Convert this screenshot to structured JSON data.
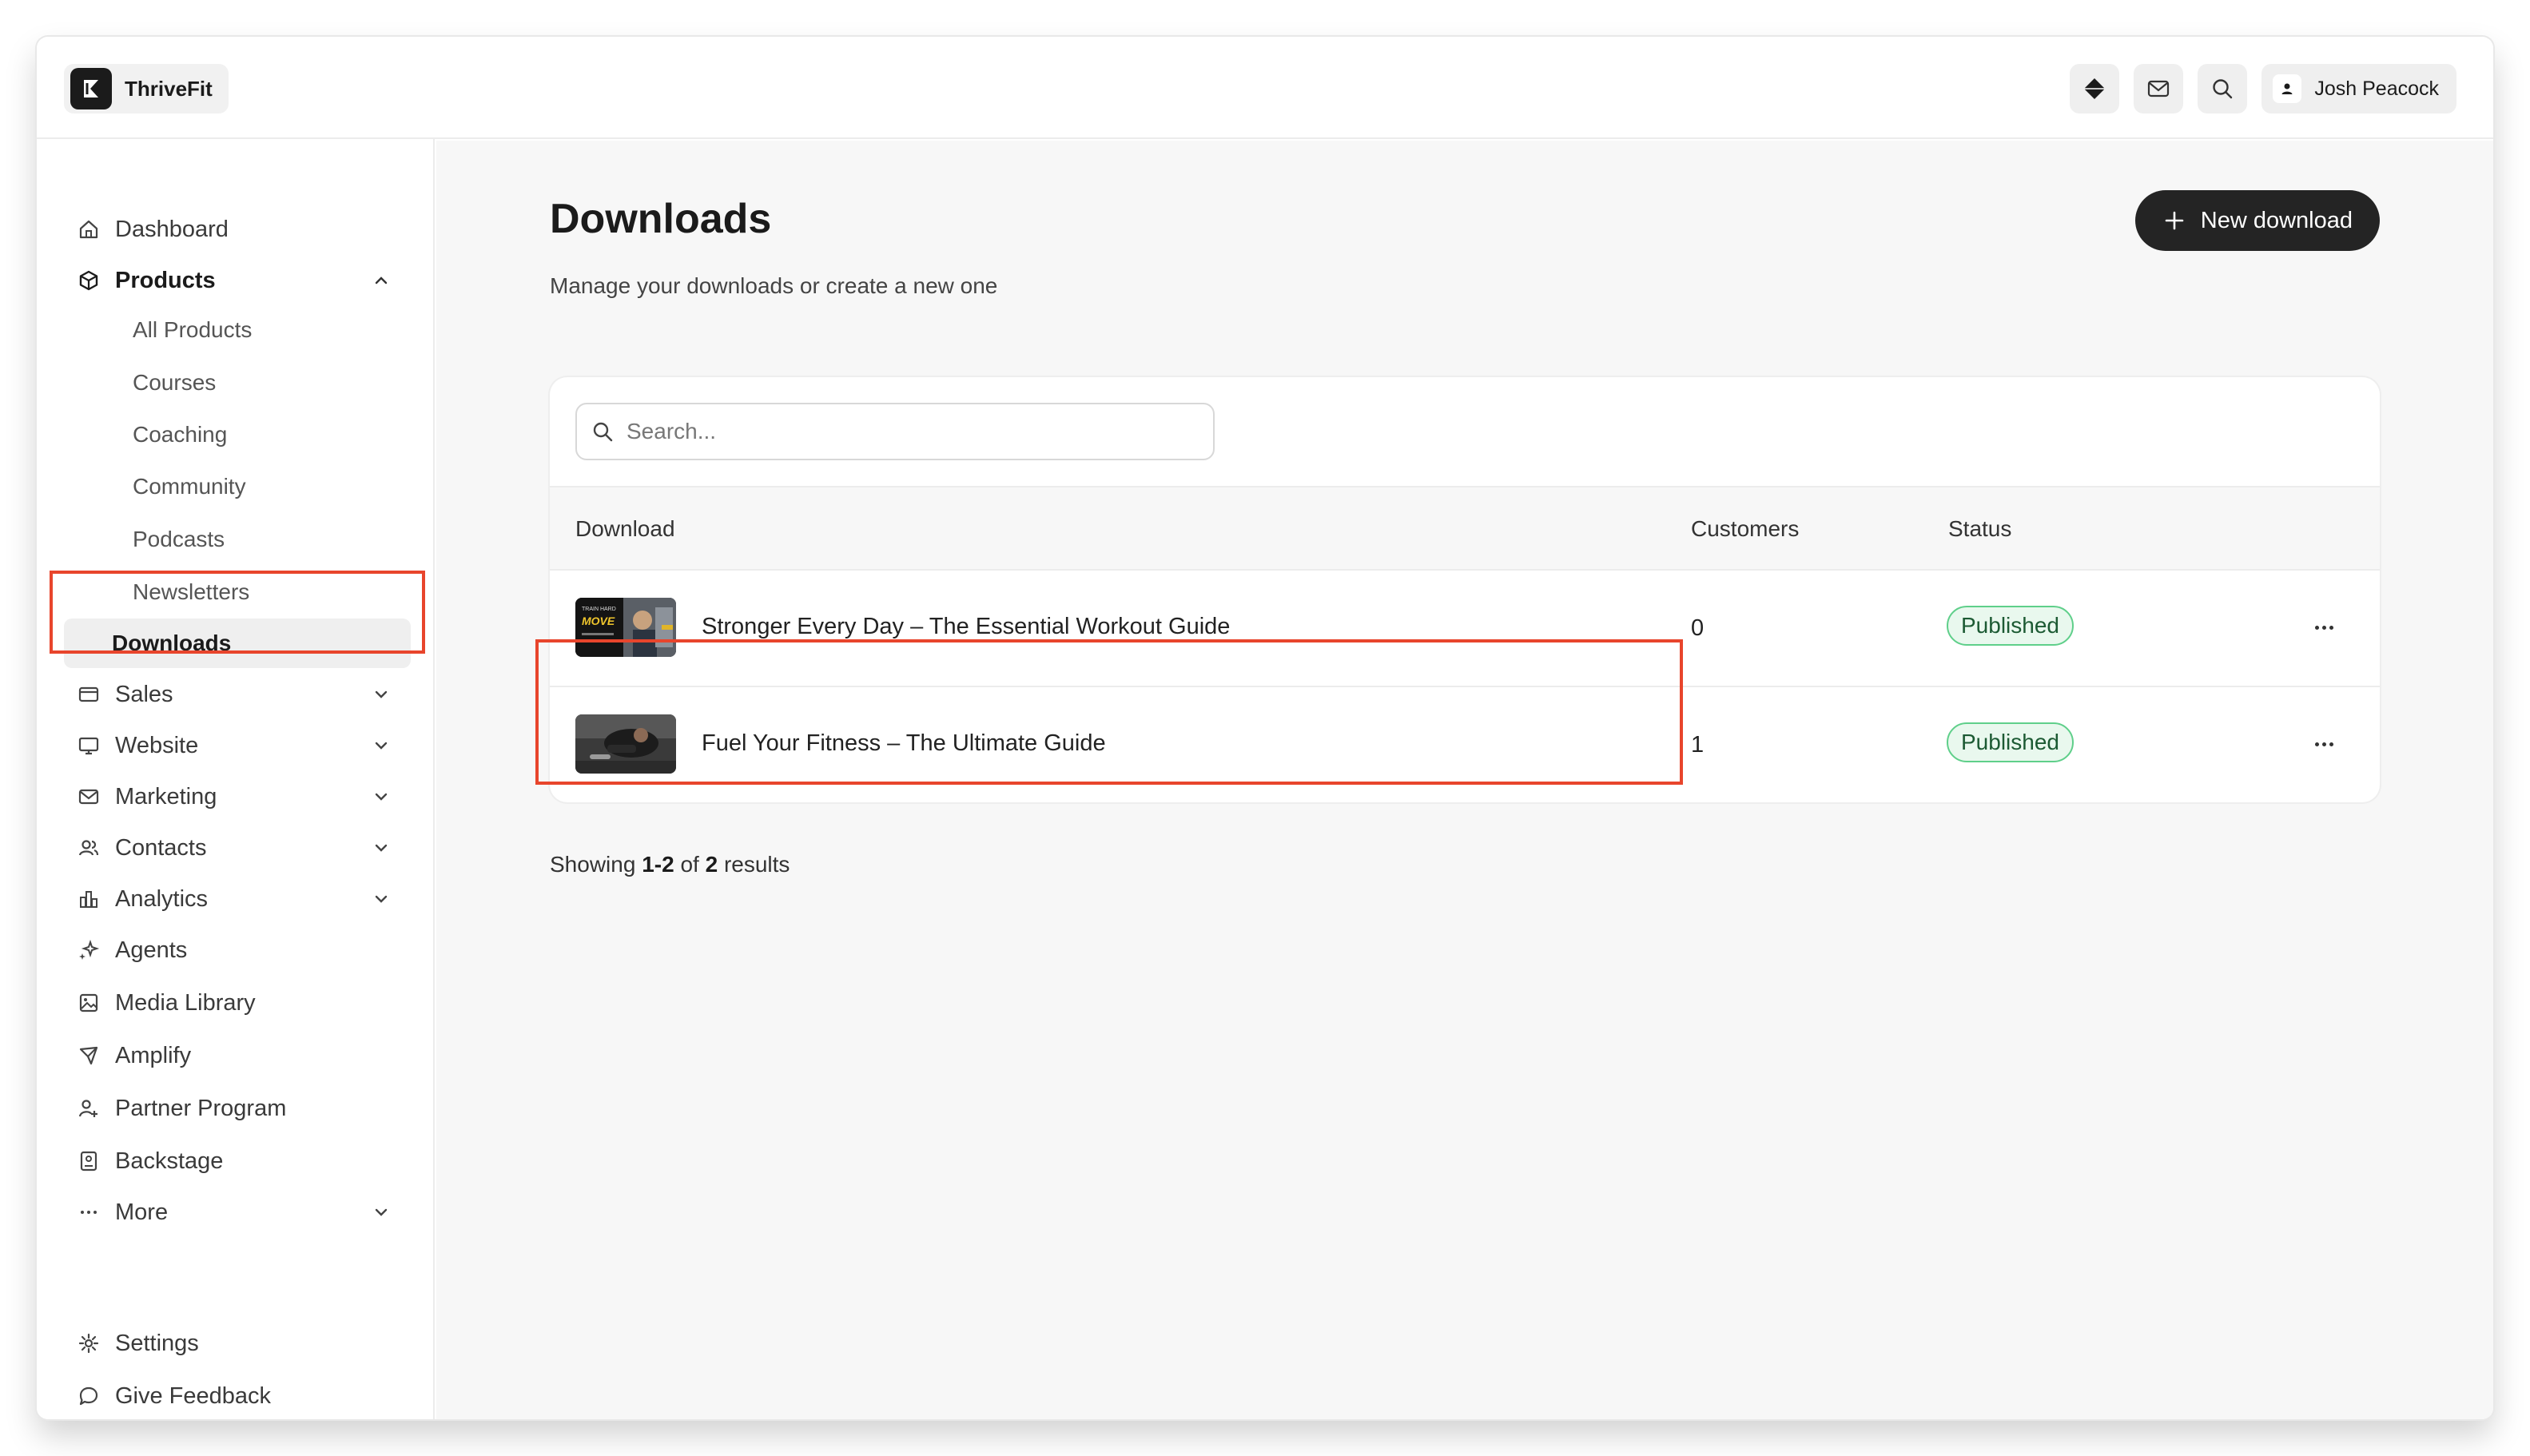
{
  "brand": {
    "name": "ThriveFit"
  },
  "header": {
    "user_name": "Josh Peacock"
  },
  "sidebar": {
    "items": [
      {
        "label": "Dashboard"
      },
      {
        "label": "Products"
      },
      {
        "label": "Sales"
      },
      {
        "label": "Website"
      },
      {
        "label": "Marketing"
      },
      {
        "label": "Contacts"
      },
      {
        "label": "Analytics"
      },
      {
        "label": "Agents"
      },
      {
        "label": "Media Library"
      },
      {
        "label": "Amplify"
      },
      {
        "label": "Partner Program"
      },
      {
        "label": "Backstage"
      },
      {
        "label": "More"
      },
      {
        "label": "Settings"
      },
      {
        "label": "Give Feedback"
      }
    ],
    "products_sub": [
      {
        "label": "All Products"
      },
      {
        "label": "Courses"
      },
      {
        "label": "Coaching"
      },
      {
        "label": "Community"
      },
      {
        "label": "Podcasts"
      },
      {
        "label": "Newsletters"
      },
      {
        "label": "Downloads"
      }
    ]
  },
  "main": {
    "title": "Downloads",
    "subtitle": "Manage your downloads or create a new one",
    "new_button": "New download",
    "search_placeholder": "Search...",
    "columns": {
      "download": "Download",
      "customers": "Customers",
      "status": "Status"
    },
    "rows": [
      {
        "title": "Stronger Every Day – The Essential Workout Guide",
        "customers": "0",
        "status": "Published",
        "thumb_text": "MOVE"
      },
      {
        "title": "Fuel Your Fitness – The Ultimate Guide",
        "customers": "1",
        "status": "Published"
      }
    ],
    "results": {
      "prefix": "Showing",
      "range": "1-2",
      "of": "of",
      "total": "2",
      "suffix": "results"
    }
  },
  "colors": {
    "accent_dark": "#242424",
    "published_bg": "#e9f8ee",
    "published_border": "#5fcf8a",
    "highlight": "#e8452c"
  }
}
